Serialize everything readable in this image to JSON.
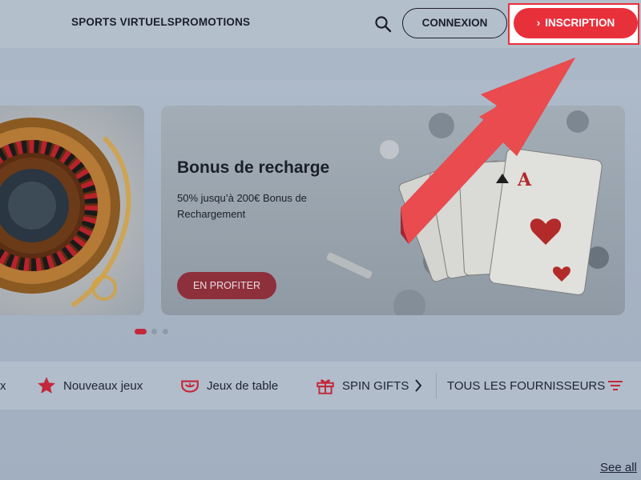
{
  "header": {
    "nav": [
      {
        "label": "SPORTS VIRTUELS"
      },
      {
        "label": "PROMOTIONS"
      }
    ],
    "login_label": "CONNEXION",
    "signup_label": "INSCRIPTION",
    "signup_chevron": "›"
  },
  "carousel": {
    "main_slide": {
      "title": "Bonus de recharge",
      "description": "50% jusqu’à 200€ Bonus de Rechargement",
      "cta_label": "EN PROFITER"
    },
    "active_index": 0,
    "dot_count": 3
  },
  "categories": {
    "partial_label": "x",
    "items": [
      {
        "label": "Nouveaux jeux",
        "icon": "star-icon"
      },
      {
        "label": "Jeux de table",
        "icon": "table-games-icon"
      },
      {
        "label": "SPIN GIFTS",
        "icon": "gift-icon"
      }
    ],
    "providers_label": "TOUS LES FOURNISSEURS"
  },
  "footer": {
    "see_all_label": "See all"
  },
  "colors": {
    "accent_red": "#e8303b",
    "cta_dark_red": "#8e2f3c",
    "text_dark": "#1b1f2a"
  }
}
